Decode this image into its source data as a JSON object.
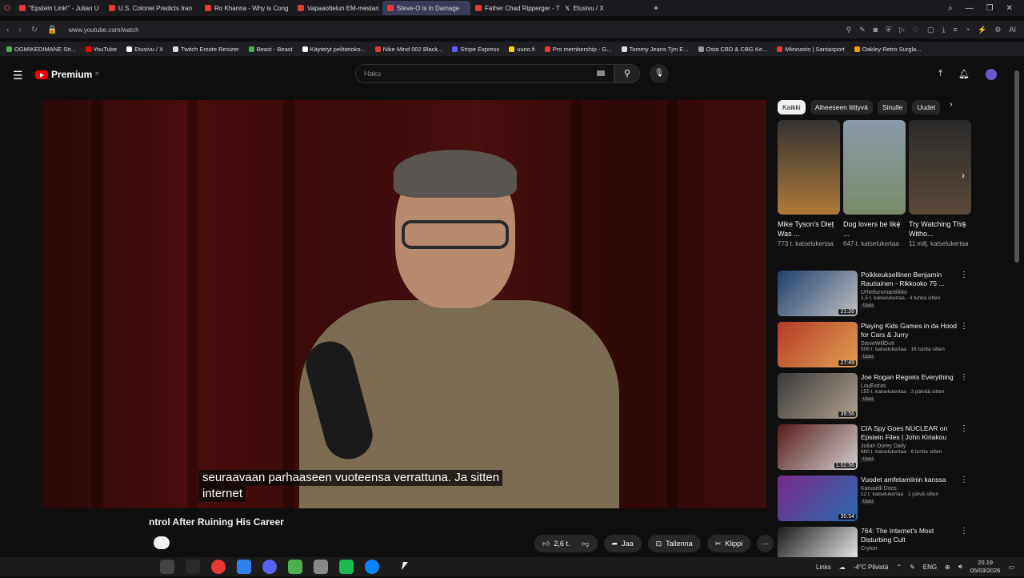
{
  "browser": {
    "tabs": [
      {
        "label": "\"Epstein Link!\" - Julian U",
        "icon_color": "#e53935"
      },
      {
        "label": "U.S. Colonel Predicts Iran",
        "icon_color": "#e53935"
      },
      {
        "label": "Ro Khanna - Why is Cong",
        "icon_color": "#e53935"
      },
      {
        "label": "Vapaaottelun EM-mestari",
        "icon_color": "#e53935"
      },
      {
        "label": "Steve-O is in Damage",
        "icon_color": "#e53935",
        "active": true
      },
      {
        "label": "Father Chad Ripperger - T",
        "icon_color": "#e53935"
      },
      {
        "label": "Etusivu / X",
        "icon_color": "#ffffff"
      }
    ],
    "url": "www.youtube.com/watch",
    "bookmarks": [
      "OGMIKEDIMANE Str...",
      "YouTube",
      "Etusivu / X",
      "Twitch Emote Resizer",
      "Beast - Beast",
      "Käytetyt pelitietoko...",
      "Nike Mind 002 Black...",
      "Stripe Express",
      "uuno.fi",
      "Pro membership - G...",
      "Tommy Jeans Tjm E...",
      "Osta CBD & CBG Ke...",
      "Miinnasto | Santasport",
      "Oakley Retro Surgla..."
    ]
  },
  "youtube": {
    "logo_text": "Premium",
    "logo_sup": "FI",
    "search_placeholder": "Haku",
    "video_title": "ntrol After Ruining His Career",
    "subtitle_line1": "seuraavaan parhaaseen vuoteensa verrattuna.  Ja sitten",
    "subtitle_line2": "internet",
    "actions": {
      "likes": "2,6 t.",
      "share": "Jaa",
      "save": "Tallenna",
      "clip": "Klippi"
    },
    "chips": [
      {
        "label": "Kaikki",
        "active": true
      },
      {
        "label": "Aiheeseen liittyvä"
      },
      {
        "label": "Sinulle"
      },
      {
        "label": "Uudet"
      }
    ],
    "shorts": [
      {
        "title": "Mike Tyson's Diet Was ...",
        "views": "773 t. katselukertaa",
        "color": "#b07a3a"
      },
      {
        "title": "Dog lovers be like ...",
        "views": "647 t. katselukertaa",
        "color": "#7a8a6a"
      },
      {
        "title": "Try Watching This Witho...",
        "views": "11 milj. katselukertaa",
        "color": "#5a4a3a"
      }
    ],
    "recommendations": [
      {
        "title": "Poikkeuksellinen Benjamin Rautiainen - Rikkooko 75 ...",
        "channel": "Urheiluromantiikko",
        "meta": "1,5 t. katselukertaa · 4 tuntia sitten",
        "badge": "Uusi",
        "duration": "21:26",
        "color": "#1d3f6e"
      },
      {
        "title": "Playing Kids Games in da Hood for Cars & Jurry",
        "channel": "SteveWillDoIt",
        "meta": "506 t. katselukertaa · 16 tuntia sitten",
        "badge": "Uusi",
        "duration": "27:49",
        "color": "#b53a2a"
      },
      {
        "title": "Joe Rogan Regrets Everything",
        "channel": "LouExtras",
        "meta": "155 t. katselukertaa · 3 päivää sitten",
        "badge": "Uusi",
        "duration": "39:56",
        "color": "#3a3a3a"
      },
      {
        "title": "CIA Spy Goes NUCLEAR on Epstein Files | John Kiriakou",
        "channel": "Julian Dorey Daily",
        "meta": "680 t. katselukertaa · 6 tuntia sitten",
        "badge": "Uusi",
        "duration": "1:02:56",
        "color": "#5a1a1a"
      },
      {
        "title": "Vuodet amfetamiinin kanssa",
        "channel": "Karuselli Docs",
        "meta": "12 t. katselukertaa · 1 päivä sitten",
        "badge": "Uusi",
        "duration": "35:54",
        "color": "#7a2a8a"
      },
      {
        "title": "764: The Internet's Most Disturbing Cult",
        "channel": "Cryton",
        "meta": "",
        "badge": "",
        "duration": "",
        "color": "#2a2a2a"
      }
    ]
  },
  "taskbar": {
    "links": "Links",
    "weather": "-4°C  Pilvistä",
    "lang": "ENG",
    "time": "20.19",
    "date": "05/03/2026"
  }
}
